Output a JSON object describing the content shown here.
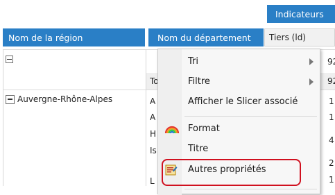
{
  "header": {
    "indicators_label": "Indicateurs",
    "region_col": "Nom de la région",
    "dept_col": "Nom du département",
    "tiers_col": "Tiers (ld)"
  },
  "rows": {
    "truncated_t1": "To",
    "region_name": "Auvergne-Rhône-Alpes",
    "truncated_cells": [
      "A",
      "A",
      "H",
      "Is",
      "L"
    ]
  },
  "right_values": [
    "92",
    "92",
    "1",
    "1",
    "4",
    "2",
    "1"
  ],
  "menu": {
    "items": [
      {
        "label": "Tri",
        "submenu": true
      },
      {
        "label": "Filtre",
        "submenu": true
      },
      {
        "label": "Afficher le Slicer associé",
        "submenu": false
      },
      {
        "label": "Format",
        "submenu": false,
        "icon": "rainbow-icon"
      },
      {
        "label": "Titre",
        "submenu": false
      },
      {
        "label": "Autres propriétés",
        "submenu": false,
        "icon": "properties-icon",
        "highlighted": true
      }
    ],
    "highlight_color": "#d0101f"
  }
}
